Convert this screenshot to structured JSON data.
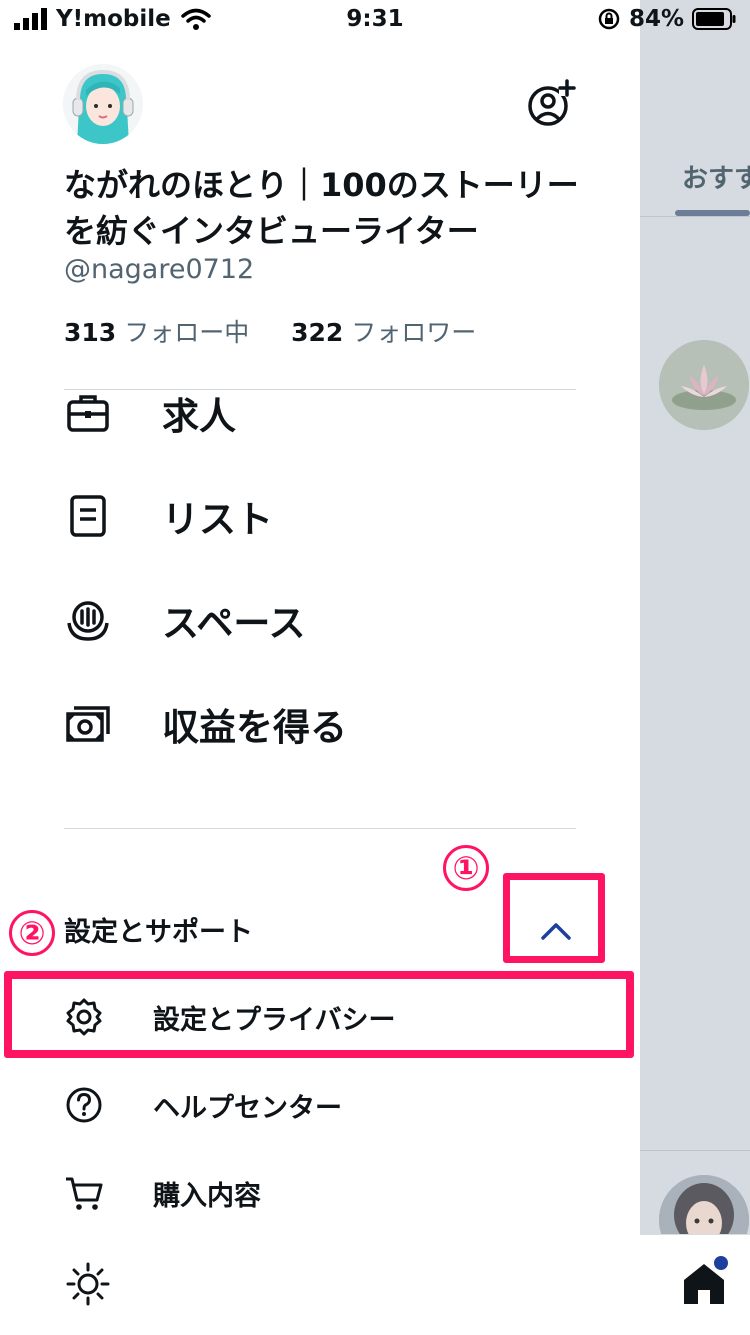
{
  "status_bar": {
    "carrier": "Y!mobile",
    "time": "9:31",
    "battery": "84%"
  },
  "drawer": {
    "display_name": "ながれのほとり｜100のストーリーを紡ぐインタビューライター",
    "handle": "@nagare0712",
    "following_count": "313",
    "following_label": "フォロー中",
    "followers_count": "322",
    "followers_label": "フォロワー",
    "menu": [
      {
        "label": "求人",
        "icon": "briefcase-icon"
      },
      {
        "label": "リスト",
        "icon": "list-icon"
      },
      {
        "label": "スペース",
        "icon": "spaces-icon"
      },
      {
        "label": "収益を得る",
        "icon": "monetization-icon"
      }
    ],
    "support_section": {
      "title": "設定とサポート",
      "expanded": true,
      "items": [
        {
          "label": "設定とプライバシー",
          "icon": "gear-icon"
        },
        {
          "label": "ヘルプセンター",
          "icon": "help-icon"
        },
        {
          "label": "購入内容",
          "icon": "cart-icon"
        }
      ]
    },
    "theme_icon": "sun-icon"
  },
  "background_feed": {
    "tab_label": "おすす"
  },
  "annotations": {
    "badge_1": "①",
    "badge_2": "②",
    "highlight_color": "#ff1464"
  },
  "colors": {
    "text_primary": "#0f1419",
    "text_secondary": "#536471",
    "accent": "#1d3f9e"
  }
}
